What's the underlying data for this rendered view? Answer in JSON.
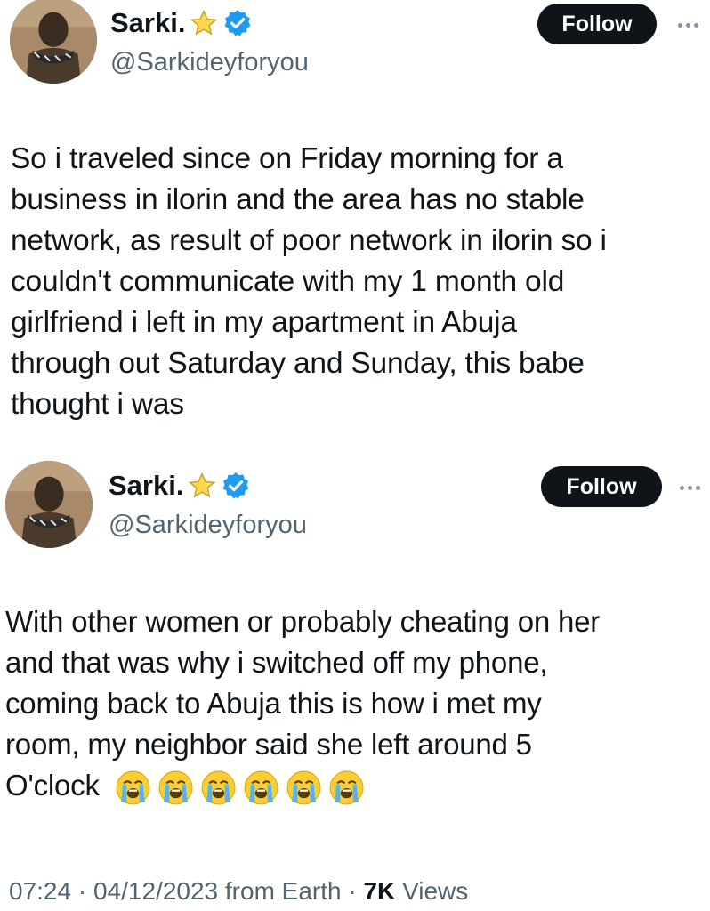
{
  "tweets": [
    {
      "author": {
        "name": "Sarki.",
        "handle": "@Sarkideyforyou",
        "badge_icon": "star-icon",
        "verified_icon": "verified-icon",
        "verified_color": "#1d9bf0"
      },
      "follow_label": "Follow",
      "more_icon": "more-icon",
      "text_lines": [
        "So i traveled since on Friday morning for a",
        "business in ilorin and the area has no stable",
        "network, as result of poor network in ilorin so i",
        "couldn't communicate with my 1 month old",
        "girlfriend i left in my apartment in Abuja",
        "through out Saturday and Sunday, this babe",
        "thought i was"
      ]
    },
    {
      "author": {
        "name": "Sarki.",
        "handle": "@Sarkideyforyou",
        "badge_icon": "star-icon",
        "verified_icon": "verified-icon",
        "verified_color": "#1d9bf0"
      },
      "follow_label": "Follow",
      "more_icon": "more-icon",
      "text_lines": [
        "With other women or probably cheating on her",
        "and that was why i switched off my phone,",
        "coming back to Abuja this is how i met my",
        "room, my neighbor said she left around 5",
        "O'clock"
      ],
      "emoji": [
        "loudly-crying-face",
        "loudly-crying-face",
        "loudly-crying-face",
        "loudly-crying-face",
        "loudly-crying-face",
        "loudly-crying-face"
      ]
    }
  ],
  "meta": {
    "time": "07:24",
    "separator": "·",
    "date": "04/12/2023",
    "source": "from Earth",
    "views_count": "7K",
    "views_label": "Views"
  },
  "colors": {
    "text": "#0f1419",
    "secondary": "#536471",
    "button_bg": "#0f1419",
    "button_text": "#ffffff"
  }
}
